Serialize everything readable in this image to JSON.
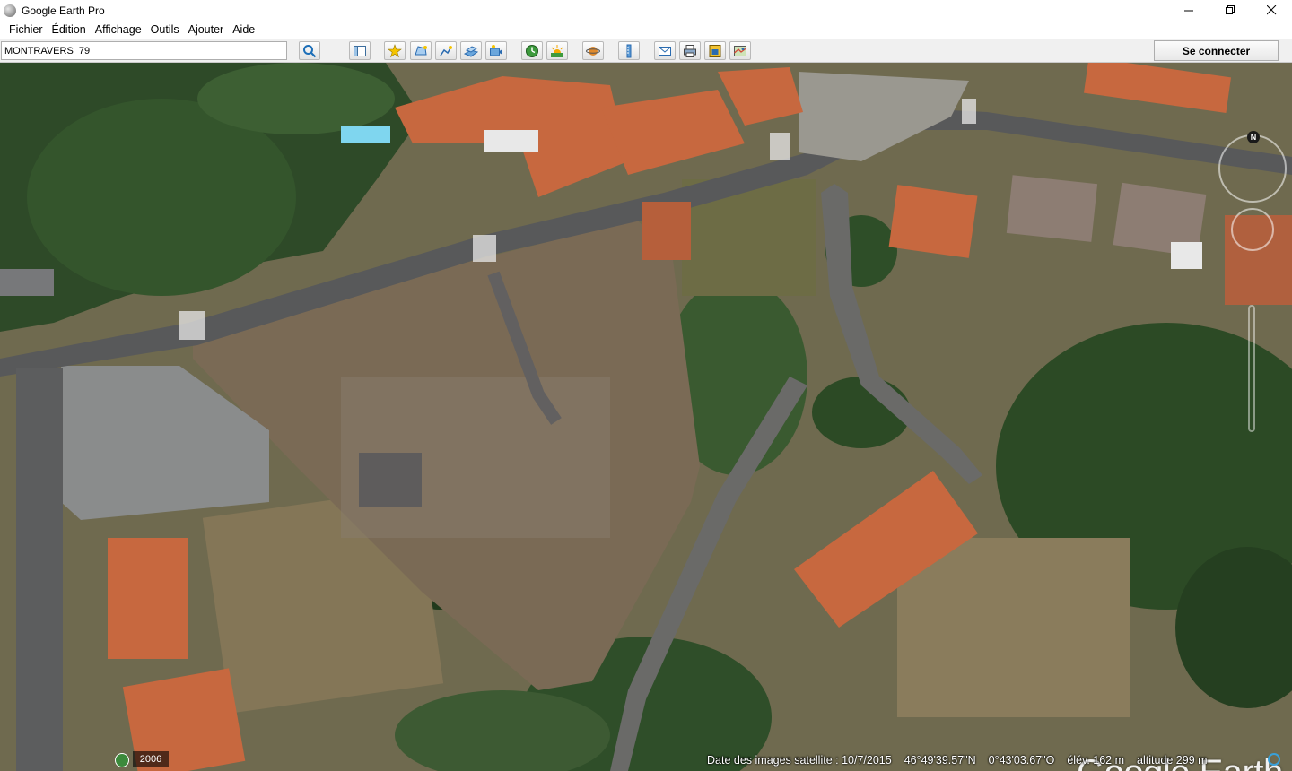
{
  "window": {
    "title": "Google Earth Pro"
  },
  "menu": [
    "Fichier",
    "Édition",
    "Affichage",
    "Outils",
    "Ajouter",
    "Aide"
  ],
  "search": {
    "value": "MONTRAVERS  79"
  },
  "toolbar": {
    "signin_label": "Se connecter",
    "icons": [
      "search-icon",
      "sidebar-icon",
      "placemark-icon",
      "polygon-icon",
      "path-icon",
      "image-overlay-icon",
      "record-tour-icon",
      "historical-imagery-icon",
      "sunlight-icon",
      "planets-icon",
      "ruler-icon",
      "email-icon",
      "print-icon",
      "save-image-icon",
      "view-in-maps-icon"
    ]
  },
  "map": {
    "logo_text": "Google Earth",
    "compass_label": "N",
    "year": "2006"
  },
  "status": {
    "imagery_date": "Date des images satellite : 10/7/2015",
    "latitude": "46°49'39.57\"N",
    "longitude": "0°43'03.67\"O",
    "elevation": "élév.  162 m",
    "eye_altitude": "altitude    299 m"
  },
  "colors": {
    "toolbar_bg": "#f0f0f0",
    "map_bg": "#6f6a4f",
    "road": "#58595a",
    "roof": "#c7683f",
    "vegetation": "#2d4a26",
    "status_indicator": "#39a0d8"
  }
}
